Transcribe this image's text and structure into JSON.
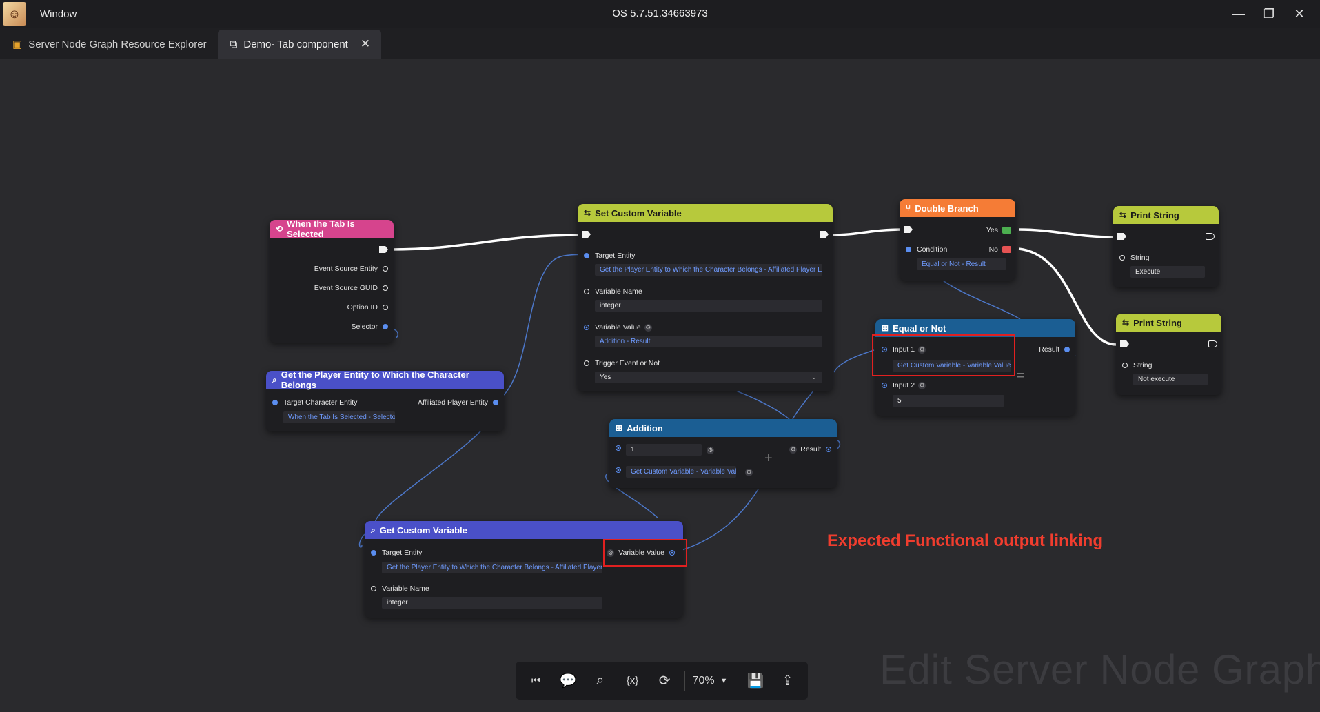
{
  "window": {
    "title": "Window",
    "version": "OS 5.7.51.34663973",
    "controls": [
      "minimize",
      "restore",
      "close"
    ]
  },
  "tabs": [
    {
      "label": "Server Node Graph Resource Explorer",
      "icon": "explorer-icon",
      "active": false
    },
    {
      "label": "Demo- Tab component",
      "icon": "graph-icon",
      "active": true
    }
  ],
  "nodes": {
    "tab_selected": {
      "title": "When the Tab Is Selected",
      "outputs": [
        "Event Source Entity",
        "Event Source GUID",
        "Option ID",
        "Selector"
      ]
    },
    "get_player": {
      "title": "Get the Player Entity to Which the Character Belongs",
      "input_label": "Target Character Entity",
      "input_value": "When the Tab Is Selected - Selector",
      "output_label": "Affiliated Player Entity"
    },
    "set_var": {
      "title": "Set Custom Variable",
      "target_label": "Target Entity",
      "target_value": "Get the Player Entity to Which the Character Belongs - Affiliated Player En",
      "name_label": "Variable Name",
      "name_value": "integer",
      "value_label": "Variable Value",
      "value_value": "Addition - Result",
      "trigger_label": "Trigger Event or Not",
      "trigger_value": "Yes"
    },
    "double_branch": {
      "title": "Double Branch",
      "yes": "Yes",
      "no": "No",
      "cond_label": "Condition",
      "cond_value": "Equal or Not - Result"
    },
    "equal": {
      "title": "Equal or Not",
      "in1_label": "Input 1",
      "in1_value": "Get Custom Variable - Variable Value",
      "in2_label": "Input 2",
      "in2_value": "5",
      "result_label": "Result",
      "operator": "="
    },
    "print1": {
      "title": "Print String",
      "str_label": "String",
      "str_value": "Execute"
    },
    "print2": {
      "title": "Print String",
      "str_label": "String",
      "str_value": "Not execute"
    },
    "addition": {
      "title": "Addition",
      "in1_value": "1",
      "in2_value": "Get Custom Variable - Variable Value",
      "result_label": "Result",
      "operator": "+"
    },
    "get_var": {
      "title": "Get Custom Variable",
      "target_label": "Target Entity",
      "target_value": "Get the Player Entity to Which the Character Belongs - Affiliated Player En",
      "output_label": "Variable Value",
      "name_label": "Variable Name",
      "name_value": "integer"
    }
  },
  "annotation": "Expected Functional output linking",
  "watermark": "Edit Server Node Graph",
  "toolbar": {
    "zoom": "70%",
    "buttons": [
      "skip-back-icon",
      "comment-icon",
      "search-icon",
      "variable-icon",
      "refresh-icon",
      "save-icon",
      "export-icon"
    ]
  },
  "colors": {
    "highlight": "#e12020",
    "link_text": "#6f9bff",
    "pink": "#d6448d",
    "lime": "#b7c93c",
    "orange": "#f57c36",
    "blue": "#1b5e93",
    "indigo": "#4a50c8"
  }
}
